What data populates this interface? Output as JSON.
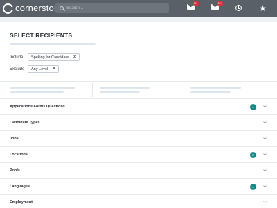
{
  "brand": {
    "name": "cornerstone"
  },
  "search": {
    "placeholder": "Search..."
  },
  "header_icons": {
    "messages": {
      "icon": "envelope-icon",
      "badge": "99+"
    },
    "inbox": {
      "icon": "envelope-check-icon",
      "badge": "99+"
    },
    "history": {
      "icon": "history-icon"
    },
    "favorites": {
      "icon": "star-icon"
    }
  },
  "page": {
    "title": "SELECT RECIPIENTS"
  },
  "filters": [
    {
      "label": "Include",
      "chip": "Spelling for Candidate"
    },
    {
      "label": "Exclude",
      "chip": "Any Level"
    }
  ],
  "sections": [
    {
      "label": "Applications Forms Questions",
      "count": "1"
    },
    {
      "label": "Candidate Types"
    },
    {
      "label": "Jobs"
    },
    {
      "label": "Locations",
      "count": "2"
    },
    {
      "label": "Pools"
    },
    {
      "label": "Languages",
      "count": "1"
    },
    {
      "label": "Employment"
    }
  ],
  "colors": {
    "header_bg": "#5a6068",
    "accent": "#138a8a",
    "badge": "#e0313a",
    "placeholder": "#dde5ee"
  }
}
